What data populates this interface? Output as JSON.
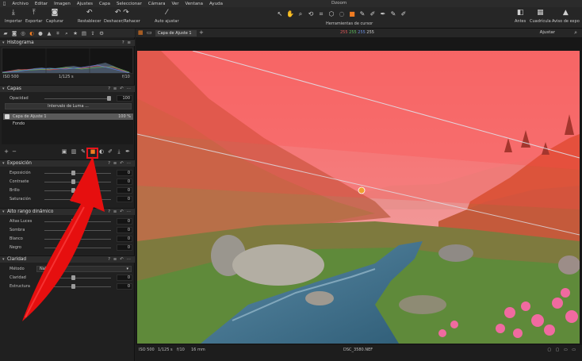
{
  "menu": {
    "items": [
      "Archivo",
      "Editar",
      "Imagen",
      "Ajustes",
      "Capa",
      "Seleccionar",
      "Cámara",
      "Ver",
      "Ventana",
      "Ayuda"
    ],
    "app_title": "Dzoom"
  },
  "toolbar": {
    "left_buttons": [
      {
        "label": "Importar",
        "icon": "download-icon"
      },
      {
        "label": "Exportar",
        "icon": "upload-icon"
      },
      {
        "label": "Capturar",
        "icon": "camera-icon"
      }
    ],
    "restablecer": "Restablecer",
    "deshacer": "Deshacer/Rehacer",
    "auto_ajustar": "Auto ajustar",
    "cursor_tools_label": "Herramientas de cursor",
    "right_buttons": [
      {
        "label": "Antes",
        "icon": "before-after-icon"
      },
      {
        "label": "Cuadrícula",
        "icon": "grid-icon"
      },
      {
        "label": "Aviso de expo",
        "icon": "warning-icon"
      }
    ]
  },
  "panel": {
    "histogram": {
      "title": "Histograma",
      "iso": "ISO 500",
      "shutter": "1/125 s",
      "aperture": "f/10"
    },
    "layers": {
      "title": "Capas",
      "opacity_label": "Opacidad",
      "opacity_value": "100",
      "luma_button": "Intervalo de Luma ...",
      "items": [
        {
          "name": "Capa de Ajuste 1",
          "opacity": "100 %"
        },
        {
          "name": "Fondo"
        }
      ]
    },
    "exposure": {
      "title": "Exposición",
      "rows": [
        {
          "label": "Exposición",
          "value": "0"
        },
        {
          "label": "Contraste",
          "value": "0"
        },
        {
          "label": "Brillo",
          "value": "0"
        },
        {
          "label": "Saturación",
          "value": "0"
        }
      ]
    },
    "hdr": {
      "title": "Alto rango dinámico",
      "rows": [
        {
          "label": "Altas Luces",
          "value": "0"
        },
        {
          "label": "Sombra",
          "value": "0"
        },
        {
          "label": "Blanco",
          "value": "0"
        },
        {
          "label": "Negro",
          "value": "0"
        }
      ]
    },
    "clarity": {
      "title": "Claridad",
      "method_label": "Método",
      "method_value": "Natural",
      "rows": [
        {
          "label": "Claridad",
          "value": "0"
        },
        {
          "label": "Estructura",
          "value": "0"
        }
      ]
    }
  },
  "viewer": {
    "variant": "Capa de Ajuste 1",
    "rgb": {
      "r": "255",
      "g": "255",
      "b": "255",
      "l": "255"
    },
    "fit_label": "Ajustar",
    "status": {
      "iso": "ISO 500",
      "shutter": "1/125 s",
      "aperture": "f/10",
      "focal": "16 mm",
      "filename": "DSC_3580.NEF"
    }
  },
  "colors": {
    "accent": "#f07c22",
    "highlight": "#e8141b",
    "mask_overlay": "#ff5a5a"
  }
}
